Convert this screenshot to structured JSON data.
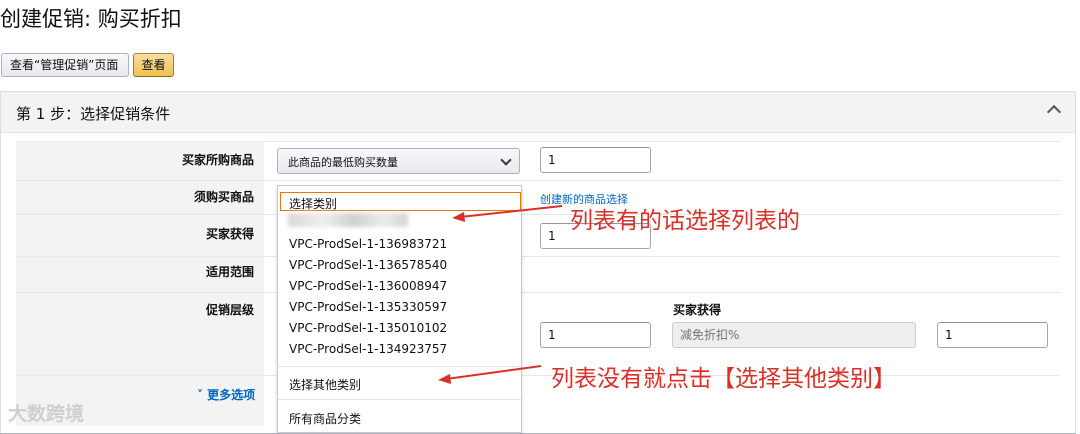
{
  "page": {
    "title": "创建促销: 购买折扣"
  },
  "toolbar": {
    "view_manage_label": "查看“管理促销”页面",
    "view_label": "查看"
  },
  "step": {
    "title": "第 1 步：选择促销条件"
  },
  "rows": {
    "buyer_purchase": {
      "label": "买家所购商品",
      "select_value": "此商品的最低购买数量",
      "qty_value": "1"
    },
    "required_items": {
      "label": "须购买商品",
      "create_link": "创建新的商品选择"
    },
    "buyer_gets": {
      "label": "买家获得",
      "qty_value": "1"
    },
    "scope": {
      "label": "适用范围"
    },
    "tiers": {
      "label": "促销层级",
      "buyer_gets_header": "买家获得",
      "qty_value": "1",
      "discount_placeholder": "减免折扣%",
      "tier_value": "1"
    }
  },
  "more_options": "˅ 更多选项",
  "dropdown": {
    "selected": "选择类别",
    "items": [
      "VPC-ProdSel-1-136983721",
      "VPC-ProdSel-1-136578540",
      "VPC-ProdSel-1-136008947",
      "VPC-ProdSel-1-135330597",
      "VPC-ProdSel-1-135010102",
      "VPC-ProdSel-1-134923757"
    ],
    "other_category": "选择其他类别",
    "all_categories": "所有商品分类"
  },
  "annotations": {
    "note1": "列表有的话选择列表的",
    "note2": "列表没有就点击【选择其他类别】",
    "color": "#d9302a"
  },
  "watermark": "大数跨境",
  "colors": {
    "link": "#0066c0",
    "primary_button": "#f0c14b",
    "selection_border": "#e47911"
  },
  "icons": {
    "collapse": "caret-up-icon",
    "select": "chevron-down-icon"
  }
}
